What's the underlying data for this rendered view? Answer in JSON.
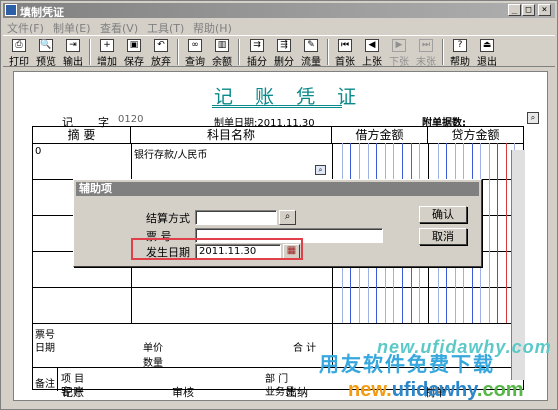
{
  "window": {
    "title": "填制凭证",
    "controls": [
      "_",
      "□",
      "×"
    ]
  },
  "menu": [
    "文件(F)",
    "制单(E)",
    "查看(V)",
    "工具(T)",
    "帮助(H)"
  ],
  "toolbar": [
    {
      "label": "打印",
      "icon": "printer-icon",
      "enabled": true
    },
    {
      "label": "预览",
      "icon": "preview-icon",
      "enabled": true
    },
    {
      "label": "输出",
      "icon": "export-icon",
      "enabled": true
    },
    {
      "label": "增加",
      "icon": "add-icon",
      "enabled": true
    },
    {
      "label": "保存",
      "icon": "save-icon",
      "enabled": true
    },
    {
      "label": "放弃",
      "icon": "undo-icon",
      "enabled": true
    },
    {
      "label": "查询",
      "icon": "binoculars-icon",
      "enabled": true
    },
    {
      "label": "余额",
      "icon": "balance-chart-icon",
      "enabled": true
    },
    {
      "label": "插分",
      "icon": "insert-row-icon",
      "enabled": true
    },
    {
      "label": "删分",
      "icon": "delete-row-icon",
      "enabled": true
    },
    {
      "label": "流量",
      "icon": "flow-icon",
      "enabled": true
    },
    {
      "label": "首张",
      "icon": "first-icon",
      "enabled": true
    },
    {
      "label": "上张",
      "icon": "prev-icon",
      "enabled": true
    },
    {
      "label": "下张",
      "icon": "next-icon",
      "enabled": false
    },
    {
      "label": "末张",
      "icon": "last-icon",
      "enabled": false
    },
    {
      "label": "帮助",
      "icon": "help-icon",
      "enabled": true
    },
    {
      "label": "退出",
      "icon": "exit-icon",
      "enabled": true
    }
  ],
  "voucher": {
    "title": "记 账 凭 证",
    "type_label": "记",
    "zi_label": "字",
    "number": "0120",
    "date_text": "制单日期:2011.11.30",
    "attach_label": "附单据数:",
    "headers": {
      "summary": "摘 要",
      "account": "科目名称",
      "debit": "借方金额",
      "credit": "贷方金额"
    },
    "row1": {
      "summary": "0",
      "account": "银行存款/人民币"
    },
    "footer": {
      "ticket_no": "票号",
      "date": "日期",
      "unit_price": "单价",
      "quantity": "数量",
      "total": "合 计",
      "remark": "备注",
      "project": "项 目",
      "customer": "客 户",
      "department": "部 门",
      "salesman": "业务员",
      "bookkeep": "记账",
      "audit": "审核",
      "cashier": "出纳",
      "preparer": "制单"
    }
  },
  "dialog": {
    "title": "辅助项",
    "settlement_label": "结算方式",
    "settlement_value": "",
    "ticket_label": "票    号",
    "ticket_value": "",
    "date_label": "发生日期",
    "date_value": "2011.11.30",
    "ok": "确认",
    "cancel": "取消"
  },
  "watermark": {
    "line1": "new.ufidawhy.com",
    "line2": "用友软件免费下载",
    "line3a": "new.",
    "line3b": "ufidawhy",
    "line3c": ".com"
  },
  "colors": {
    "title_teal": "#0a8a8a",
    "highlight": "#e0404a"
  }
}
